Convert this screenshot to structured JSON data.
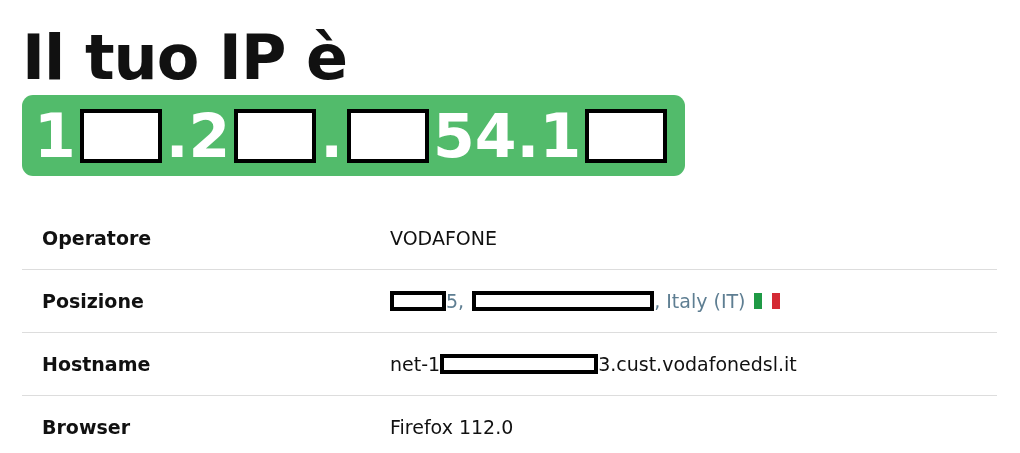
{
  "heading": "Il tuo IP è",
  "ip": [
    {
      "kind": "text",
      "text": "1"
    },
    {
      "kind": "redacted"
    },
    {
      "kind": "text",
      "text": ".2"
    },
    {
      "kind": "redacted"
    },
    {
      "kind": "text",
      "text": "."
    },
    {
      "kind": "redacted"
    },
    {
      "kind": "text",
      "text": "54.1"
    },
    {
      "kind": "redacted"
    }
  ],
  "rows": [
    {
      "label": "Operatore",
      "kind": "plain",
      "parts": [
        {
          "kind": "text",
          "text": "VODAFONE"
        }
      ]
    },
    {
      "label": "Posizione",
      "kind": "location",
      "parts": [
        {
          "kind": "redacted"
        },
        {
          "kind": "text",
          "text": "5,"
        },
        {
          "kind": "redacted"
        },
        {
          "kind": "text",
          "text": ", Italy (IT)"
        },
        {
          "kind": "flag"
        }
      ]
    },
    {
      "label": "Hostname",
      "kind": "plain",
      "parts": [
        {
          "kind": "text",
          "text": "net-1"
        },
        {
          "kind": "redacted"
        },
        {
          "kind": "text",
          "text": "3.cust.vodafonedsl.it"
        }
      ]
    },
    {
      "label": "Browser",
      "kind": "plain",
      "parts": [
        {
          "kind": "text",
          "text": "Firefox 112.0"
        }
      ]
    }
  ]
}
